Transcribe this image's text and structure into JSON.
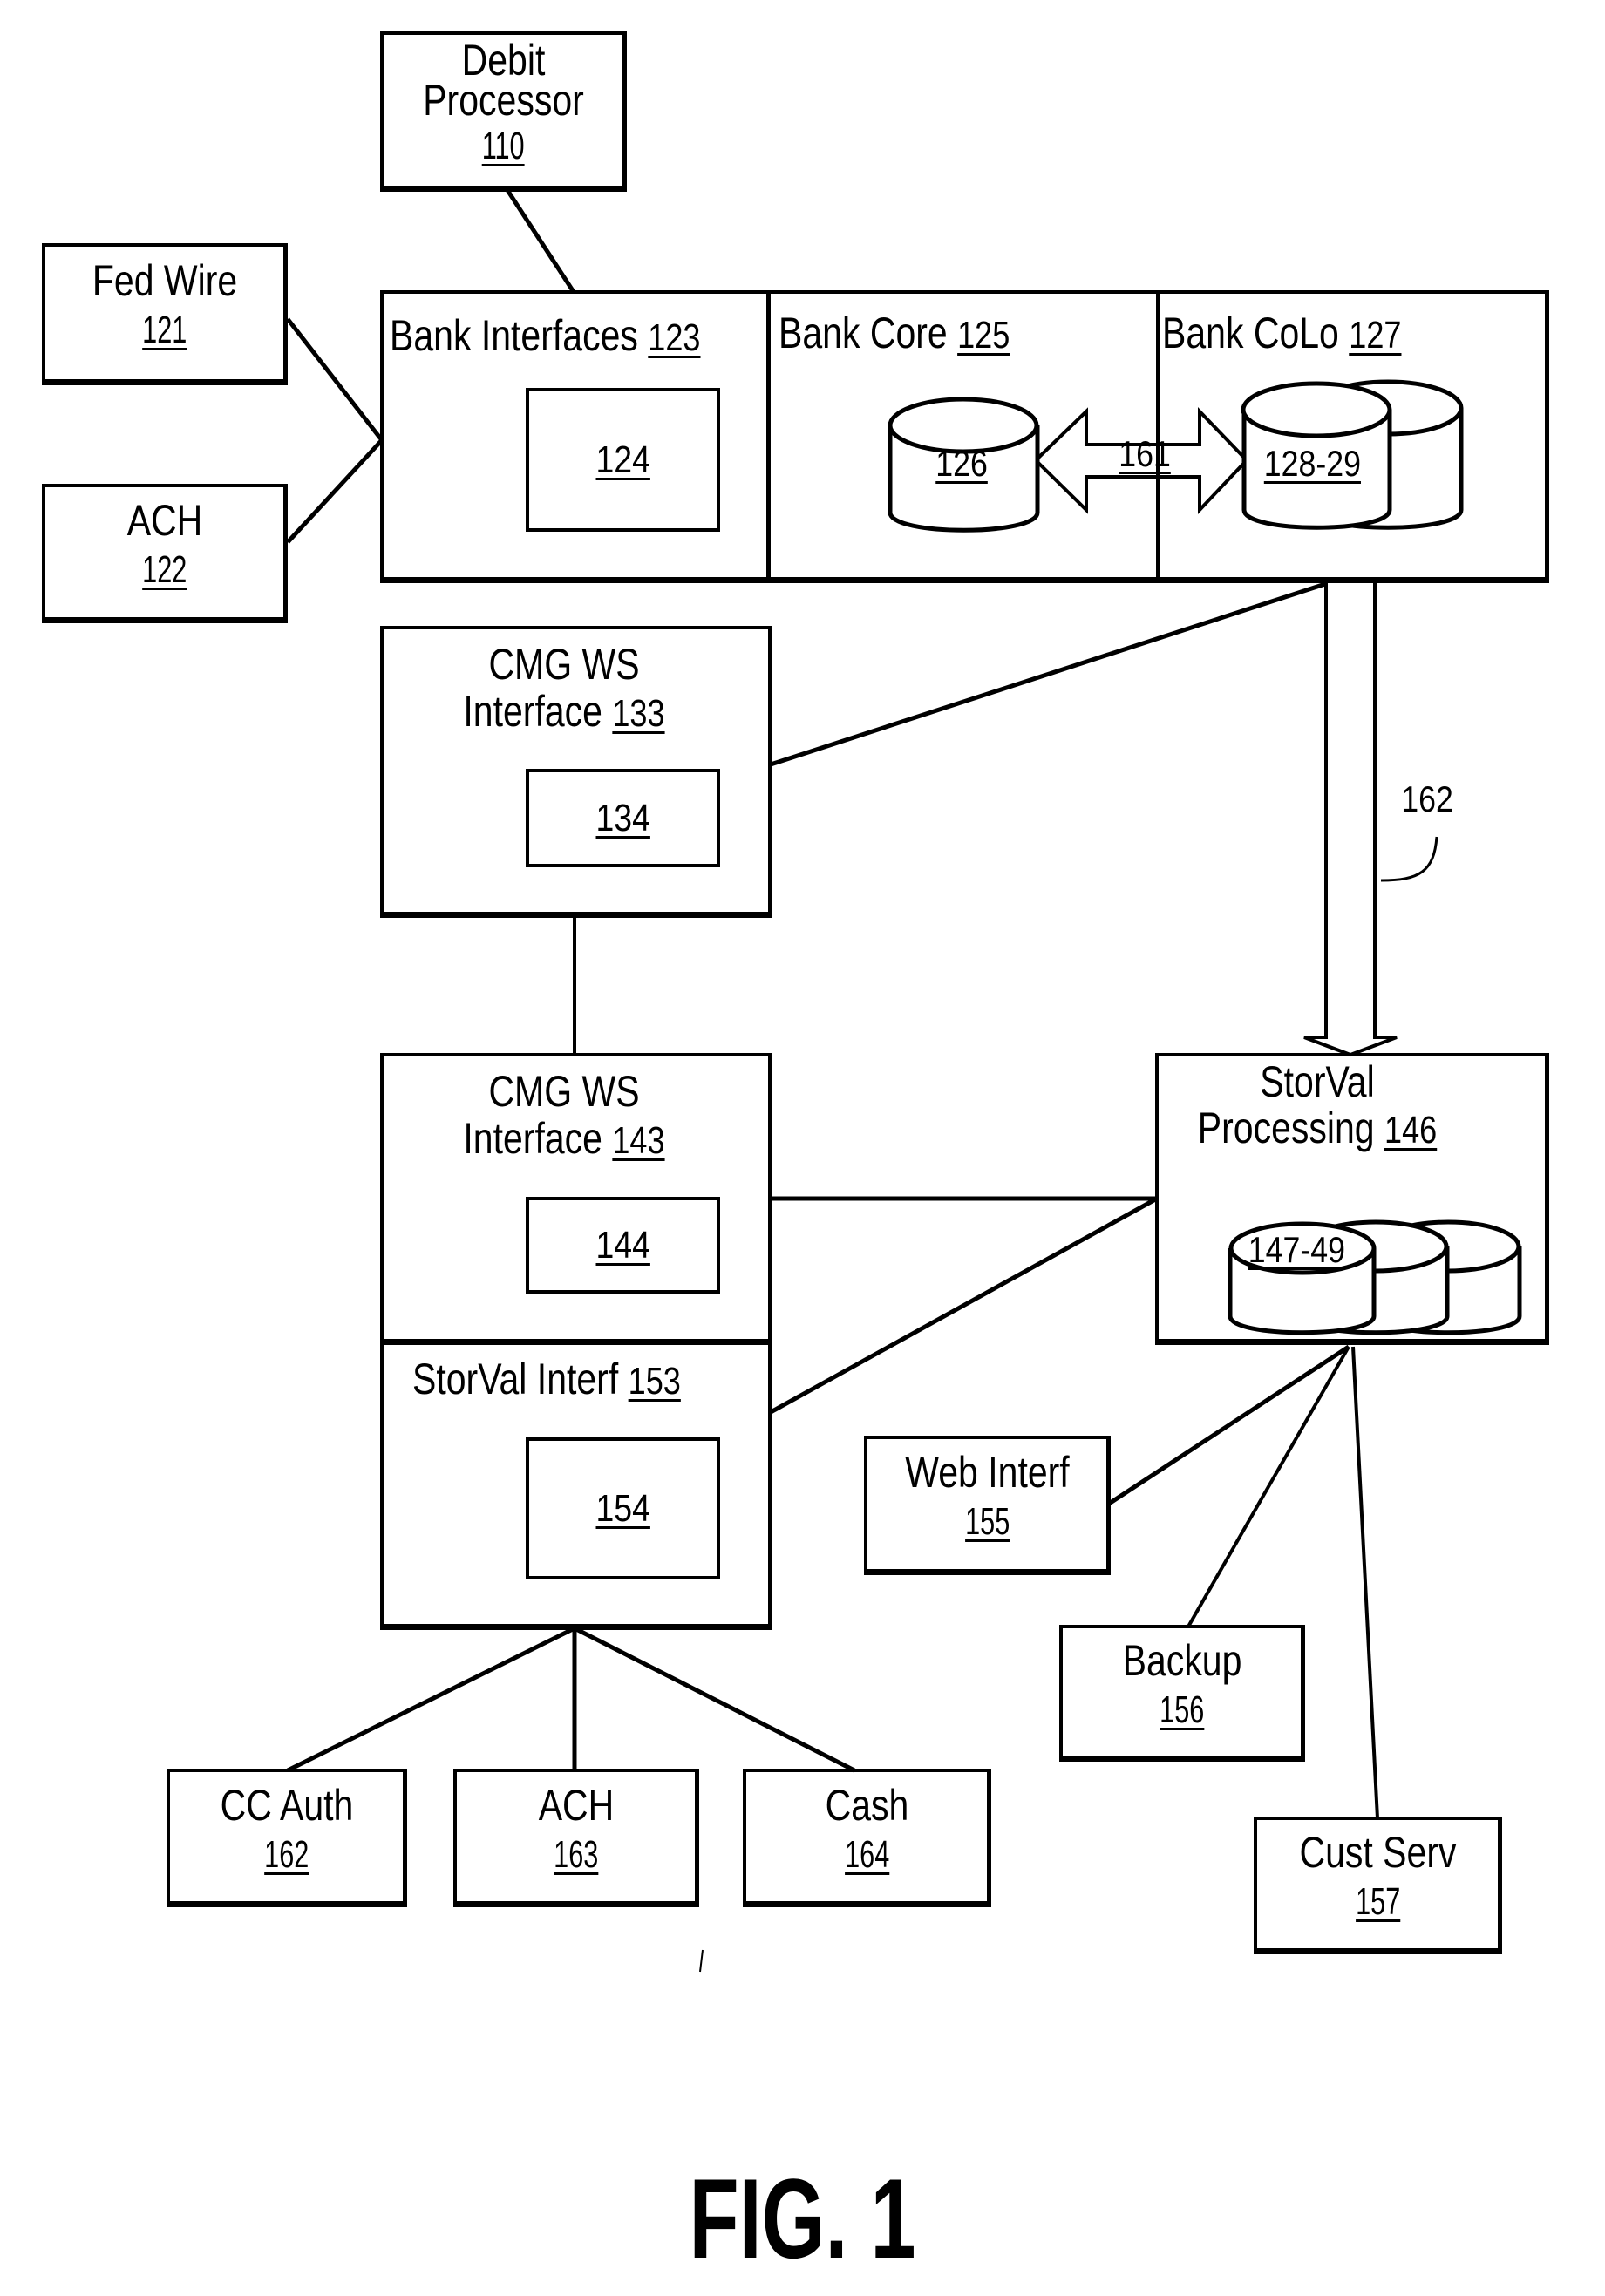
{
  "figure": {
    "caption": "FIG. 1"
  },
  "nodes": {
    "debit_processor": {
      "line1": "Debit",
      "line2": "Processor",
      "ref": "110"
    },
    "fed_wire": {
      "line1": "Fed Wire",
      "ref": "121"
    },
    "ach_in": {
      "line1": "ACH",
      "ref": "122"
    },
    "bank_interfaces": {
      "title": "Bank Interfaces",
      "ref": "123",
      "inner_ref": "124"
    },
    "bank_core": {
      "title": "Bank Core",
      "ref": "125",
      "db_ref": "126"
    },
    "bank_colo": {
      "title": "Bank CoLo",
      "ref": "127",
      "db_ref": "128-29"
    },
    "link_161": {
      "ref": "161"
    },
    "link_162": {
      "ref": "162"
    },
    "cmg_ws_133": {
      "line1": "CMG WS",
      "line2": "Interface",
      "ref": "133",
      "inner_ref": "134"
    },
    "cmg_ws_143": {
      "line1": "CMG WS",
      "line2": "Interface",
      "ref": "143",
      "inner_ref": "144"
    },
    "storval_interf": {
      "title": "StorVal Interf",
      "ref": "153",
      "inner_ref": "154"
    },
    "storval_processing": {
      "line1": "StorVal",
      "line2": "Processing",
      "ref": "146",
      "db_ref": "147-49"
    },
    "web_interf": {
      "line1": "Web Interf",
      "ref": "155"
    },
    "backup": {
      "line1": "Backup",
      "ref": "156"
    },
    "cust_serv": {
      "line1": "Cust Serv",
      "ref": "157"
    },
    "cc_auth": {
      "line1": "CC Auth",
      "ref": "162"
    },
    "ach_out": {
      "line1": "ACH",
      "ref": "163"
    },
    "cash": {
      "line1": "Cash",
      "ref": "164"
    }
  }
}
